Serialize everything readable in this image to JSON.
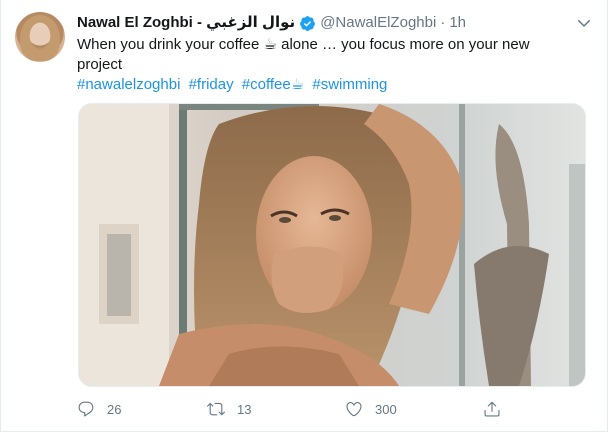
{
  "tweet": {
    "author": {
      "display_name": "Nawal El Zoghbi - نوال الزغبي",
      "handle": "@NawalElZoghbi",
      "time": "1h",
      "separator": "·",
      "verified": true
    },
    "text": "When you drink your coffee ☕ alone … you focus more  on your new project",
    "hashtags": [
      "#nawalelzoghbi",
      "#friday",
      "#coffee☕",
      "#swimming"
    ],
    "actions": {
      "replies": "26",
      "retweets": "13",
      "likes": "300"
    }
  },
  "colors": {
    "accent": "#1b95e0",
    "verified": "#1da1f2",
    "muted": "#657786",
    "text": "#14171a"
  },
  "icons": {
    "verified": "verified-badge-icon",
    "menu": "chevron-down-icon",
    "reply": "reply-icon",
    "retweet": "retweet-icon",
    "like": "heart-icon",
    "share": "share-icon"
  }
}
